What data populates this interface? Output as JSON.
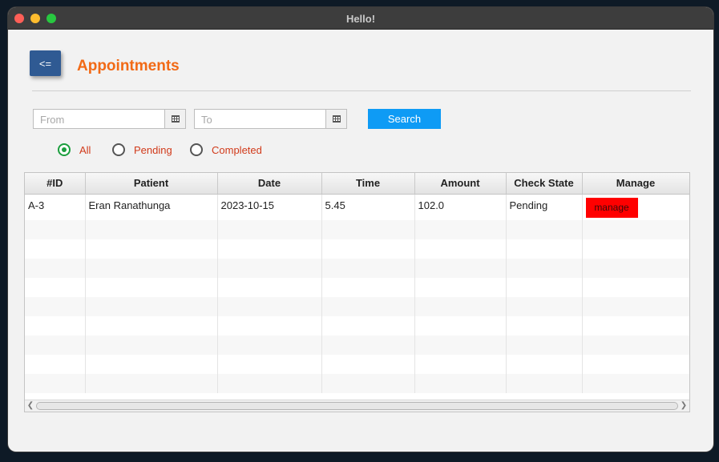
{
  "window": {
    "title": "Hello!"
  },
  "header": {
    "back_label": "<=",
    "title": "Appointments"
  },
  "filters": {
    "from_placeholder": "From",
    "to_placeholder": "To",
    "search_label": "Search",
    "status_options": [
      {
        "label": "All",
        "checked": true
      },
      {
        "label": "Pending",
        "checked": false
      },
      {
        "label": "Completed",
        "checked": false
      }
    ]
  },
  "table": {
    "columns": [
      "#ID",
      "Patient",
      "Date",
      "Time",
      "Amount",
      "Check State",
      "Manage"
    ],
    "rows": [
      {
        "id": "A-3",
        "patient": "Eran Ranathunga",
        "date": "2023-10-15",
        "time": "5.45",
        "amount": "102.0",
        "state": "Pending",
        "action": "manage"
      }
    ]
  },
  "colors": {
    "accent": "#f26a16",
    "back_button": "#2f5a93",
    "search_button": "#0e9bf5",
    "manage_button": "#ff0000",
    "radio_checked": "#1b9e3e",
    "radio_label": "#d13a1a"
  }
}
